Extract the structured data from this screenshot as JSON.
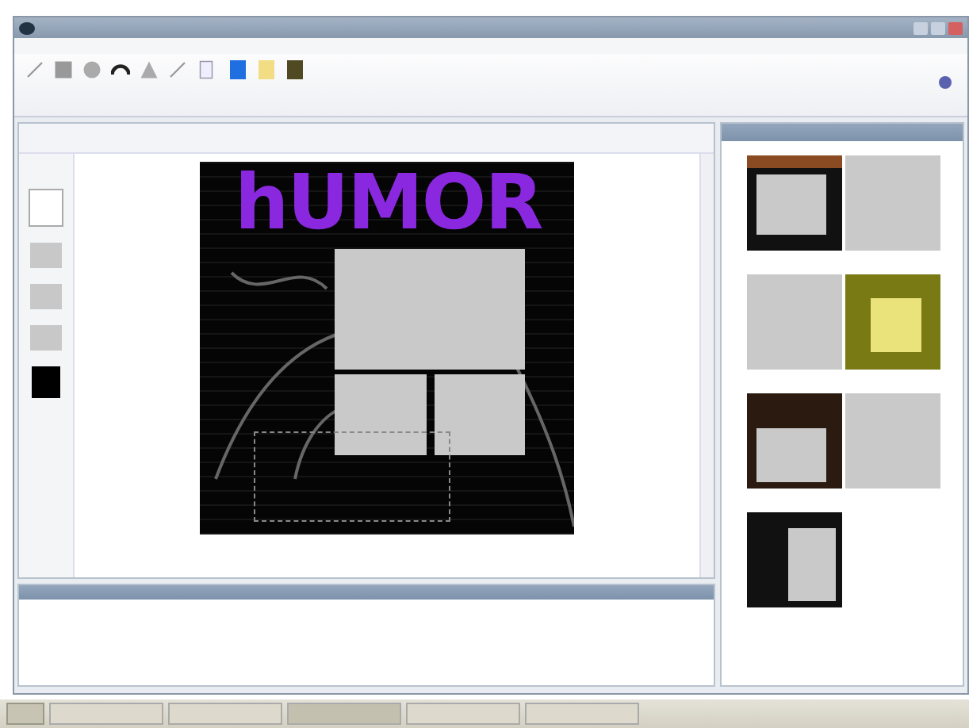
{
  "page": {
    "title": "hUMOR"
  },
  "swatches": [
    {
      "color": "#1f6fe0"
    },
    {
      "color": "#f2dc84"
    },
    {
      "color": "#4f4a22"
    }
  ]
}
